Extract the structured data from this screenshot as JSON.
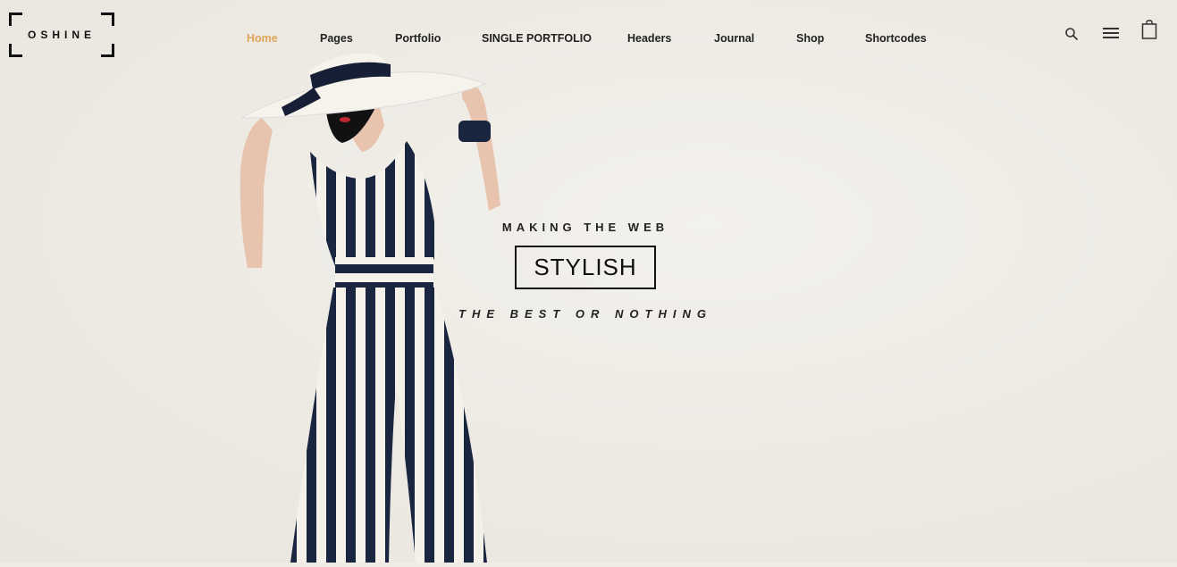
{
  "logo": {
    "text": "OSHINE"
  },
  "nav": {
    "items": [
      {
        "label": "Home",
        "active": true
      },
      {
        "label": "Pages"
      },
      {
        "label": "Portfolio"
      },
      {
        "label": "SINGLE PORTFOLIO"
      },
      {
        "label": "Headers"
      },
      {
        "label": "Journal"
      },
      {
        "label": "Shop"
      },
      {
        "label": "Shortcodes"
      }
    ],
    "active_color": "#e0a557"
  },
  "header_icons": [
    "search-icon",
    "menu-icon",
    "cart-icon"
  ],
  "hero": {
    "line1": "MAKING THE WEB",
    "highlight": "STYLISH",
    "line3": "THE BEST OR NOTHING"
  },
  "colors": {
    "background": "#efece5",
    "text": "#222222"
  }
}
